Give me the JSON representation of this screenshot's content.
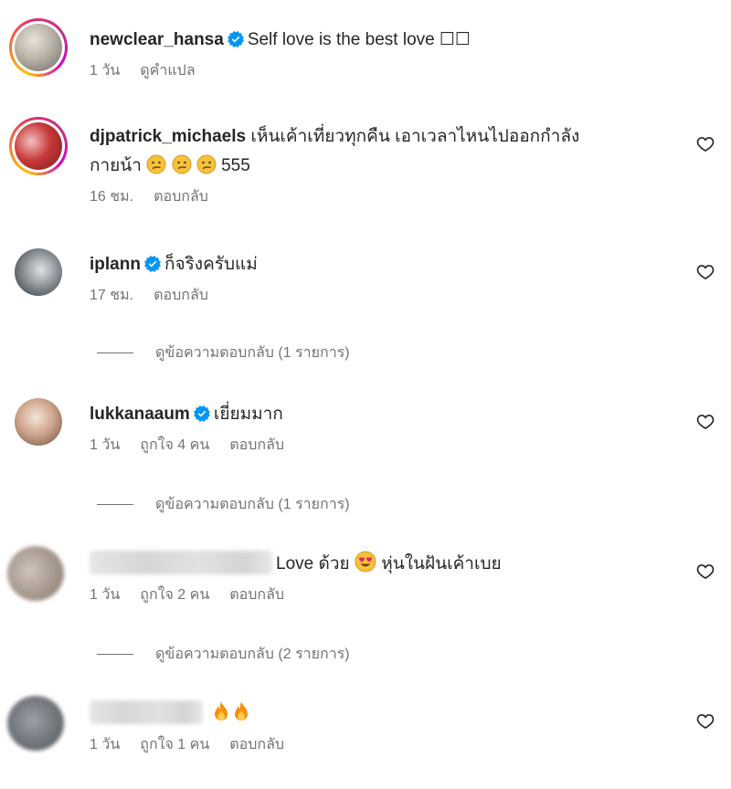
{
  "comments": [
    {
      "username": "newclear_hansa",
      "verified": true,
      "text": "Self love is the best love ☐☐",
      "time": "1 วัน",
      "action": "ดูคำแปล",
      "avatar_icon": "avatar-story"
    },
    {
      "username": "djpatrick_michaels",
      "verified": false,
      "text_line1": "เห็นเค้าเที่ยวทุกคืน เอาเวลาไหนไปออกกำลัง",
      "text_line2_pre": "กายน้า",
      "text_line2_post": "555",
      "emoji": "confused-face-emoji",
      "time": "16 ชม.",
      "reply": "ตอบกลับ"
    },
    {
      "username": "iplann",
      "verified": true,
      "text": "ก็จริงครับแม่",
      "time": "17 ชม.",
      "reply": "ตอบกลับ",
      "view_replies": "ดูข้อความตอบกลับ (1 รายการ)"
    },
    {
      "username": "lukkanaaum",
      "verified": true,
      "text": "เยี่ยมมาก",
      "time": "1 วัน",
      "likes": "ถูกใจ 4 คน",
      "reply": "ตอบกลับ",
      "view_replies": "ดูข้อความตอบกลับ (1 รายการ)"
    },
    {
      "username_blurred": true,
      "text_pre": "Love ด้วย",
      "emoji": "heart-eyes-emoji",
      "text_post": "หุ่นในฝันเค้าเบย",
      "time": "1 วัน",
      "likes": "ถูกใจ 2 คน",
      "reply": "ตอบกลับ",
      "view_replies": "ดูข้อความตอบกลับ (2 รายการ)"
    },
    {
      "username_blurred": true,
      "emoji": "fire-emoji",
      "time": "1 วัน",
      "likes": "ถูกใจ 1 คน",
      "reply": "ตอบกลับ"
    }
  ],
  "icons": {
    "like": "heart-outline-icon",
    "verified": "verified-badge-icon"
  },
  "colors": {
    "text": "#262626",
    "secondary": "#737373",
    "verified": "#0095f6"
  }
}
